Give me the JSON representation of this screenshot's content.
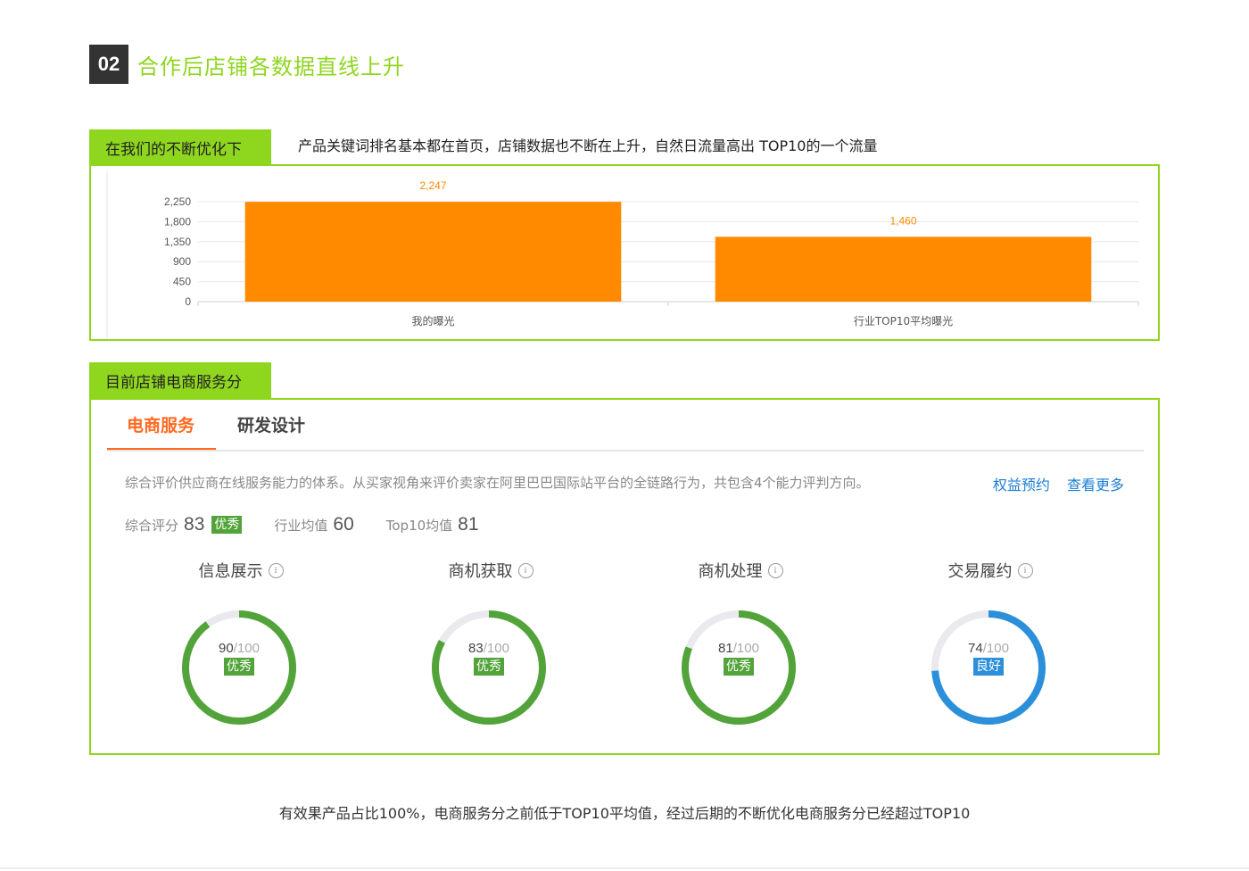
{
  "section": {
    "number": "02",
    "title": "合作后店铺各数据直线上升"
  },
  "exposure": {
    "label": "在我们的不断优化下",
    "description": "产品关键词排名基本都在首页，店铺数据也不断在上升，自然日流量高出 TOP10的一个流量"
  },
  "chart_data": {
    "type": "bar",
    "categories": [
      "我的曝光",
      "行业TOP10平均曝光"
    ],
    "values": [
      2247,
      1460
    ],
    "value_labels": [
      "2,247",
      "1,460"
    ],
    "yticks": [
      "0",
      "450",
      "900",
      "1,350",
      "1,800",
      "2,250"
    ],
    "ylim": [
      0,
      2250
    ],
    "grid": true,
    "bar_color": "#ff8a00"
  },
  "service": {
    "label": "目前店铺电商服务分",
    "tabs": [
      "电商服务",
      "研发设计"
    ],
    "description": "综合评价供应商在线服务能力的体系。从买家视角来评价卖家在阿里巴巴国际站平台的全链路行为，共包含4个能力评判方向。",
    "links": [
      "权益预约",
      "查看更多"
    ],
    "overall": {
      "label": "综合评分",
      "value": "83",
      "badge": "优秀"
    },
    "industry": {
      "label": "行业均值",
      "value": "60"
    },
    "top10": {
      "label": "Top10均值",
      "value": "81"
    },
    "metrics": [
      {
        "title": "信息展示",
        "score": 90,
        "score_text": "90",
        "max_text": "/100",
        "badge": "优秀",
        "color": "#52a33a"
      },
      {
        "title": "商机获取",
        "score": 83,
        "score_text": "83",
        "max_text": "/100",
        "badge": "优秀",
        "color": "#52a33a"
      },
      {
        "title": "商机处理",
        "score": 81,
        "score_text": "81",
        "max_text": "/100",
        "badge": "优秀",
        "color": "#52a33a"
      },
      {
        "title": "交易履约",
        "score": 74,
        "score_text": "74",
        "max_text": "/100",
        "badge": "良好",
        "color": "#2b8fda"
      }
    ]
  },
  "footer": "有效果产品占比100%，电商服务分之前低于TOP10平均值，经过后期的不断优化电商服务分已经超过TOP10"
}
